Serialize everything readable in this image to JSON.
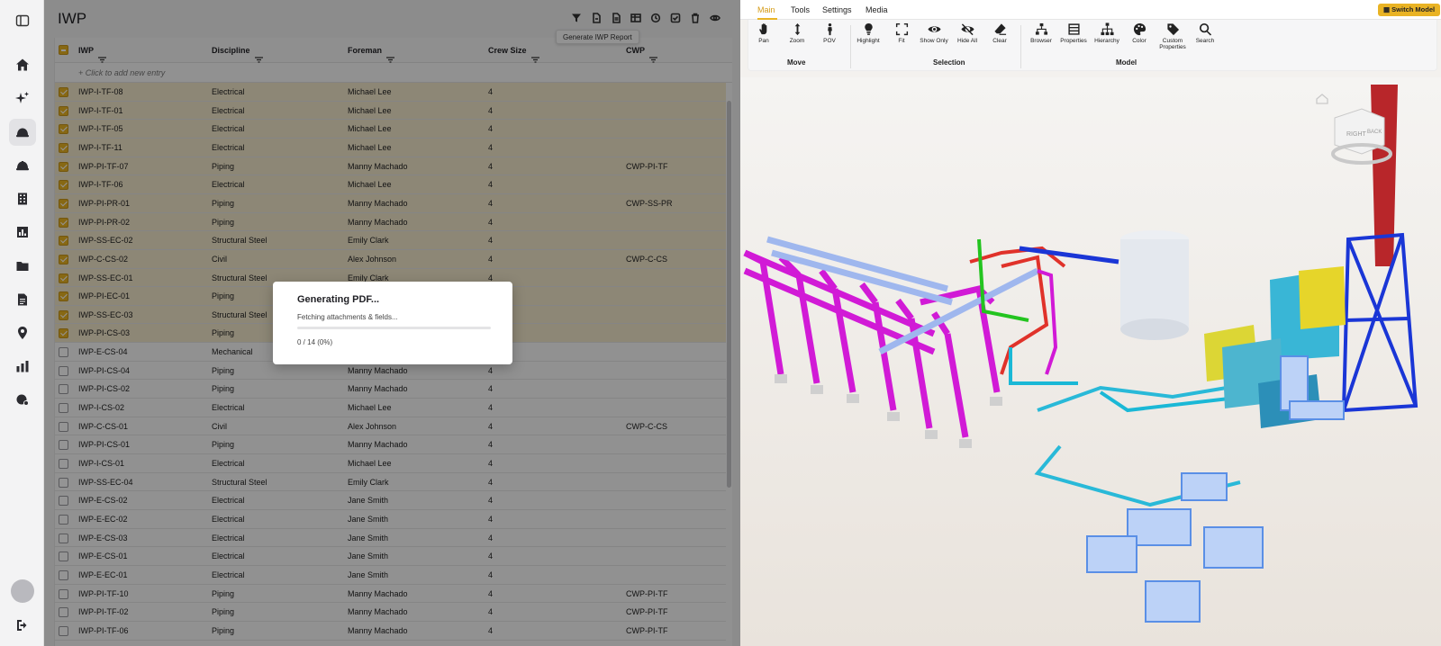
{
  "left_panel": {
    "title": "IWP",
    "tooltip": "Generate IWP Report",
    "toolbar_icons": [
      "filter-icon",
      "export-icon",
      "report-icon",
      "table-icon",
      "sync-icon",
      "check-icon",
      "trash-icon",
      "eye-icon"
    ],
    "columns": [
      "IWP",
      "Discipline",
      "Foreman",
      "Crew Size",
      "CWP"
    ],
    "add_entry": "+ Click to add new entry",
    "rows": [
      {
        "iwp": "IWP-I-TF-08",
        "discipline": "Electrical",
        "foreman": "Michael Lee",
        "crew": "4",
        "cwp": "",
        "selected": true
      },
      {
        "iwp": "IWP-I-TF-01",
        "discipline": "Electrical",
        "foreman": "Michael Lee",
        "crew": "4",
        "cwp": "",
        "selected": true
      },
      {
        "iwp": "IWP-I-TF-05",
        "discipline": "Electrical",
        "foreman": "Michael Lee",
        "crew": "4",
        "cwp": "",
        "selected": true
      },
      {
        "iwp": "IWP-I-TF-11",
        "discipline": "Electrical",
        "foreman": "Michael Lee",
        "crew": "4",
        "cwp": "",
        "selected": true
      },
      {
        "iwp": "IWP-PI-TF-07",
        "discipline": "Piping",
        "foreman": "Manny Machado",
        "crew": "4",
        "cwp": "CWP-PI-TF",
        "selected": true
      },
      {
        "iwp": "IWP-I-TF-06",
        "discipline": "Electrical",
        "foreman": "Michael Lee",
        "crew": "4",
        "cwp": "",
        "selected": true
      },
      {
        "iwp": "IWP-PI-PR-01",
        "discipline": "Piping",
        "foreman": "Manny Machado",
        "crew": "4",
        "cwp": "CWP-SS-PR",
        "selected": true
      },
      {
        "iwp": "IWP-PI-PR-02",
        "discipline": "Piping",
        "foreman": "Manny Machado",
        "crew": "4",
        "cwp": "",
        "selected": true
      },
      {
        "iwp": "IWP-SS-EC-02",
        "discipline": "Structural Steel",
        "foreman": "Emily Clark",
        "crew": "4",
        "cwp": "",
        "selected": true
      },
      {
        "iwp": "IWP-C-CS-02",
        "discipline": "Civil",
        "foreman": "Alex Johnson",
        "crew": "4",
        "cwp": "CWP-C-CS",
        "selected": true
      },
      {
        "iwp": "IWP-SS-EC-01",
        "discipline": "Structural Steel",
        "foreman": "Emily Clark",
        "crew": "4",
        "cwp": "",
        "selected": true
      },
      {
        "iwp": "IWP-PI-EC-01",
        "discipline": "Piping",
        "foreman": "",
        "crew": "",
        "cwp": "",
        "selected": true
      },
      {
        "iwp": "IWP-SS-EC-03",
        "discipline": "Structural Steel",
        "foreman": "",
        "crew": "",
        "cwp": "",
        "selected": true
      },
      {
        "iwp": "IWP-PI-CS-03",
        "discipline": "Piping",
        "foreman": "",
        "crew": "",
        "cwp": "",
        "selected": true
      },
      {
        "iwp": "IWP-E-CS-04",
        "discipline": "Mechanical",
        "foreman": "",
        "crew": "",
        "cwp": "",
        "selected": false
      },
      {
        "iwp": "IWP-PI-CS-04",
        "discipline": "Piping",
        "foreman": "Manny Machado",
        "crew": "4",
        "cwp": "",
        "selected": false
      },
      {
        "iwp": "IWP-PI-CS-02",
        "discipline": "Piping",
        "foreman": "Manny Machado",
        "crew": "4",
        "cwp": "",
        "selected": false
      },
      {
        "iwp": "IWP-I-CS-02",
        "discipline": "Electrical",
        "foreman": "Michael Lee",
        "crew": "4",
        "cwp": "",
        "selected": false
      },
      {
        "iwp": "IWP-C-CS-01",
        "discipline": "Civil",
        "foreman": "Alex Johnson",
        "crew": "4",
        "cwp": "CWP-C-CS",
        "selected": false
      },
      {
        "iwp": "IWP-PI-CS-01",
        "discipline": "Piping",
        "foreman": "Manny Machado",
        "crew": "4",
        "cwp": "",
        "selected": false
      },
      {
        "iwp": "IWP-I-CS-01",
        "discipline": "Electrical",
        "foreman": "Michael Lee",
        "crew": "4",
        "cwp": "",
        "selected": false
      },
      {
        "iwp": "IWP-SS-EC-04",
        "discipline": "Structural Steel",
        "foreman": "Emily Clark",
        "crew": "4",
        "cwp": "",
        "selected": false
      },
      {
        "iwp": "IWP-E-CS-02",
        "discipline": "Electrical",
        "foreman": "Jane Smith",
        "crew": "4",
        "cwp": "",
        "selected": false
      },
      {
        "iwp": "IWP-E-EC-02",
        "discipline": "Electrical",
        "foreman": "Jane Smith",
        "crew": "4",
        "cwp": "",
        "selected": false
      },
      {
        "iwp": "IWP-E-CS-03",
        "discipline": "Electrical",
        "foreman": "Jane Smith",
        "crew": "4",
        "cwp": "",
        "selected": false
      },
      {
        "iwp": "IWP-E-CS-01",
        "discipline": "Electrical",
        "foreman": "Jane Smith",
        "crew": "4",
        "cwp": "",
        "selected": false
      },
      {
        "iwp": "IWP-E-EC-01",
        "discipline": "Electrical",
        "foreman": "Jane Smith",
        "crew": "4",
        "cwp": "",
        "selected": false
      },
      {
        "iwp": "IWP-PI-TF-10",
        "discipline": "Piping",
        "foreman": "Manny Machado",
        "crew": "4",
        "cwp": "CWP-PI-TF",
        "selected": false
      },
      {
        "iwp": "IWP-PI-TF-02",
        "discipline": "Piping",
        "foreman": "Manny Machado",
        "crew": "4",
        "cwp": "CWP-PI-TF",
        "selected": false
      },
      {
        "iwp": "IWP-PI-TF-06",
        "discipline": "Piping",
        "foreman": "Manny Machado",
        "crew": "4",
        "cwp": "CWP-PI-TF",
        "selected": false
      }
    ]
  },
  "modal": {
    "title": "Generating PDF...",
    "subtitle": "Fetching attachments & fields...",
    "progress_text": "0 / 14 (0%)",
    "progress_fraction": 0
  },
  "sidebar": {
    "icons": [
      "sidebar-toggle-icon",
      "home-icon",
      "sparkle-icon",
      "hardhat-icon",
      "hardhat-outline-icon",
      "building-icon",
      "chart-icon",
      "folder-icon",
      "document-icon",
      "location-icon",
      "analytics-icon",
      "shield-icon",
      "avatar",
      "logout-icon"
    ],
    "active": "hardhat-icon"
  },
  "viewer": {
    "tabs": [
      "Main",
      "Tools",
      "Settings",
      "Media"
    ],
    "active_tab": "Main",
    "switch_model": "Switch Model",
    "groups": {
      "move": "Move",
      "selection": "Selection",
      "model": "Model"
    },
    "buttons": {
      "pan": "Pan",
      "zoom": "Zoom",
      "pov": "POV",
      "highlight": "Highlight",
      "fit": "Fit",
      "show_only": "Show Only",
      "hide_all": "Hide All",
      "clear": "Clear",
      "browser": "Browser",
      "properties": "Properties",
      "hierarchy": "Hierarchy",
      "color": "Color",
      "custom_properties": "Custom Properties",
      "search": "Search"
    },
    "viewcube": {
      "right": "RIGHT",
      "back": "BACK"
    }
  },
  "colors": {
    "accent": "#e9b324",
    "selected_row": "#f3e8cc"
  }
}
